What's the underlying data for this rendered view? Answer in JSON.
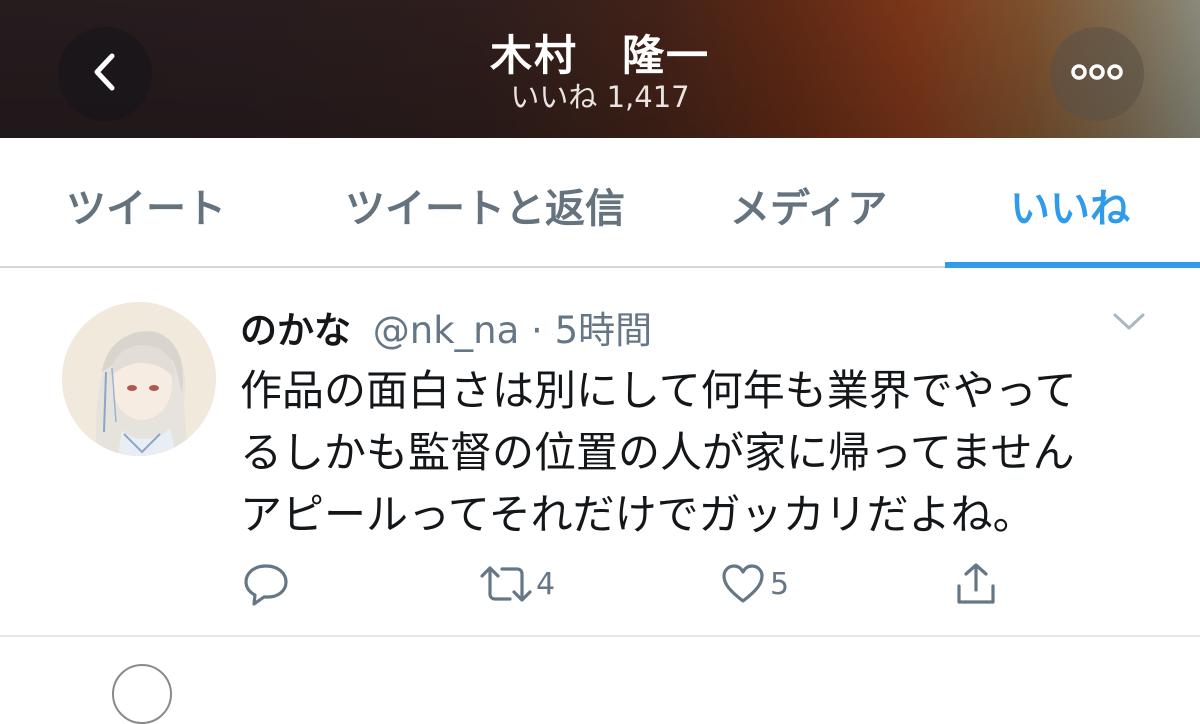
{
  "header": {
    "title": "木村　隆一",
    "subtitle": "いいね 1,417",
    "back_icon": "chevron-left-icon",
    "more_icon": "more-dots-icon"
  },
  "tabs": [
    {
      "label": "ツイート",
      "active": false
    },
    {
      "label": "ツイートと返信",
      "active": false
    },
    {
      "label": "メディア",
      "active": false
    },
    {
      "label": "いいね",
      "active": true
    }
  ],
  "tweet": {
    "display_name": "のかな",
    "handle": "@nk_na",
    "time": "· 5時間",
    "text_lines": [
      "作品の面白さは別にして何年も業界でやって",
      "るしかも監督の位置の人が家に帰ってません",
      "アピールってそれだけでガッカリだよね。"
    ],
    "actions": {
      "reply_icon": "reply-icon",
      "retweet_icon": "retweet-icon",
      "retweet_count": "4",
      "like_icon": "heart-icon",
      "like_count": "5",
      "share_icon": "share-icon"
    }
  },
  "colors": {
    "accent": "#2f9be9",
    "muted": "#657786",
    "text": "#14171a"
  }
}
